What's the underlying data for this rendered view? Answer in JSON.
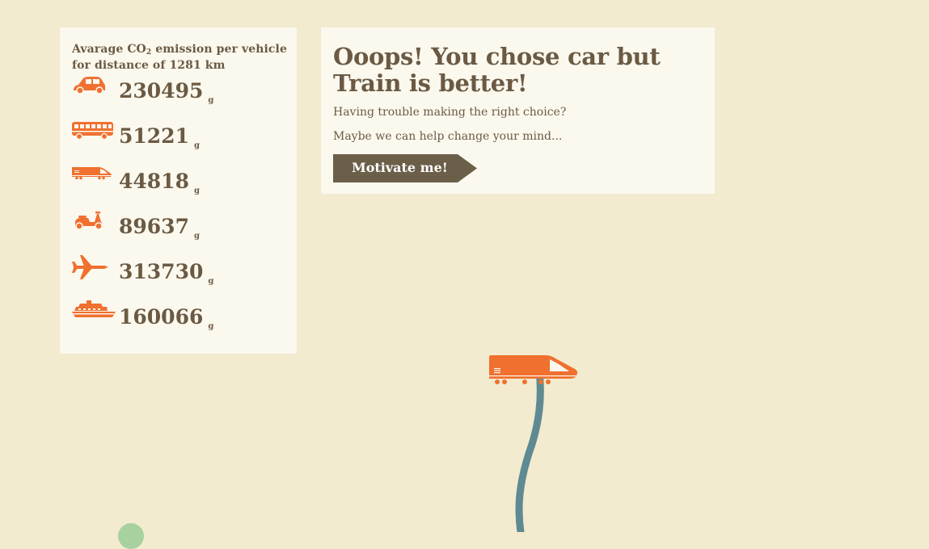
{
  "stats": {
    "title_prefix": "Avarage CO",
    "title_sub": "2",
    "title_suffix": " emission per vehicle for distance of 1281 km",
    "unit": "g",
    "rows": [
      {
        "icon": "car-icon",
        "value": "230495"
      },
      {
        "icon": "bus-icon",
        "value": "51221"
      },
      {
        "icon": "train-icon",
        "value": "44818"
      },
      {
        "icon": "scooter-icon",
        "value": "89637"
      },
      {
        "icon": "airplane-icon",
        "value": "313730"
      },
      {
        "icon": "ship-icon",
        "value": "160066"
      }
    ]
  },
  "message": {
    "title": "Ooops! You chose car but Train is better!",
    "line1": "Having trouble making the right choice?",
    "line2": "Maybe we can help change your mind...",
    "button_label": "Motivate me!"
  },
  "colors": {
    "background": "#f2ebcf",
    "panel": "#fbf8ee",
    "text": "#6b5a43",
    "accent": "#f0702f",
    "button": "#6b5f49",
    "route": "#5f8a92",
    "marker": "#a7d2a0"
  }
}
